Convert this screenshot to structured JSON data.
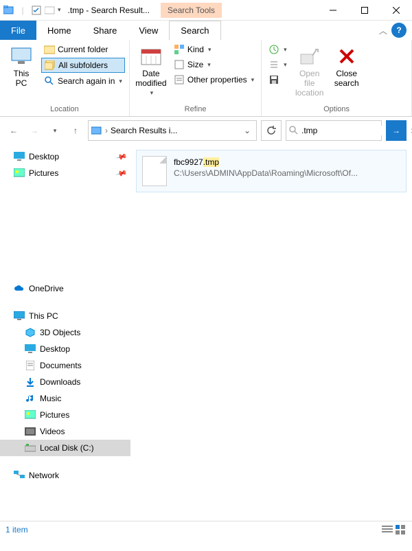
{
  "title": ".tmp - Search Result...",
  "contextual_tab": "Search Tools",
  "tabs": {
    "file": "File",
    "home": "Home",
    "share": "Share",
    "view": "View",
    "search": "Search"
  },
  "ribbon": {
    "location": {
      "this_pc": "This\nPC",
      "current_folder": "Current folder",
      "all_subfolders": "All subfolders",
      "search_again": "Search again in",
      "label": "Location"
    },
    "refine": {
      "date": "Date\nmodified",
      "kind": "Kind",
      "size": "Size",
      "other": "Other properties",
      "label": "Refine"
    },
    "options": {
      "recent": "",
      "advanced": "",
      "save": "",
      "open": "Open file\nlocation",
      "close": "Close\nsearch",
      "label": "Options"
    }
  },
  "address": {
    "text": "Search Results i...",
    "crumb": "›"
  },
  "search": {
    "value": ".tmp"
  },
  "nav": {
    "quick": [
      "Desktop",
      "Pictures"
    ],
    "onedrive": "OneDrive",
    "thispc": "This PC",
    "thispc_items": [
      "3D Objects",
      "Desktop",
      "Documents",
      "Downloads",
      "Music",
      "Pictures",
      "Videos",
      "Local Disk (C:)"
    ],
    "network": "Network"
  },
  "result": {
    "name_base": "fbc9927",
    "name_ext": ".tmp",
    "path": "C:\\Users\\ADMIN\\AppData\\Roaming\\Microsoft\\Of..."
  },
  "status": {
    "count": "1 item"
  }
}
